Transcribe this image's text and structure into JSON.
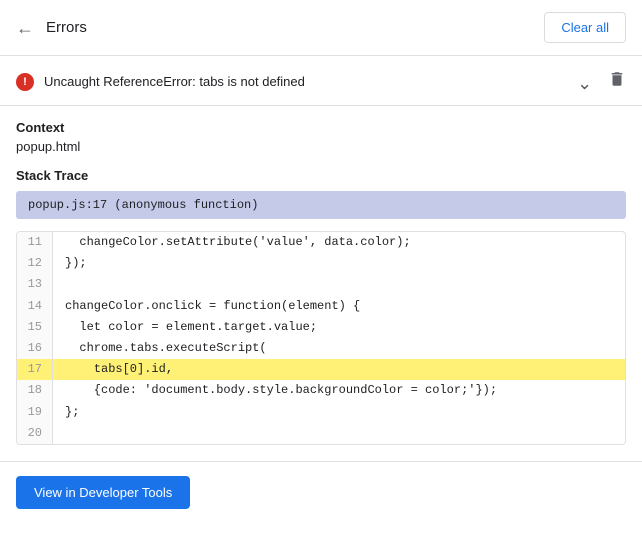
{
  "header": {
    "back_label": "←",
    "title": "Errors",
    "clear_all_label": "Clear all"
  },
  "error": {
    "icon_label": "!",
    "message": "Uncaught ReferenceError: tabs is not defined",
    "context_label": "Context",
    "context_value": "popup.html",
    "stack_trace_label": "Stack Trace",
    "stack_trace_value": "popup.js:17 (anonymous function)",
    "code_lines": [
      {
        "num": "11",
        "content": "  changeColor.setAttribute('value', data.color);",
        "highlighted": false
      },
      {
        "num": "12",
        "content": "});",
        "highlighted": false
      },
      {
        "num": "13",
        "content": "",
        "highlighted": false
      },
      {
        "num": "14",
        "content": "changeColor.onclick = function(element) {",
        "highlighted": false
      },
      {
        "num": "15",
        "content": "  let color = element.target.value;",
        "highlighted": false
      },
      {
        "num": "16",
        "content": "  chrome.tabs.executeScript(",
        "highlighted": false
      },
      {
        "num": "17",
        "content": "    tabs[0].id,",
        "highlighted": true
      },
      {
        "num": "18",
        "content": "    {code: 'document.body.style.backgroundColor = color;'});",
        "highlighted": false
      },
      {
        "num": "19",
        "content": "};",
        "highlighted": false
      },
      {
        "num": "20",
        "content": "",
        "highlighted": false
      }
    ]
  },
  "footer": {
    "view_btn_label": "View in Developer Tools"
  }
}
